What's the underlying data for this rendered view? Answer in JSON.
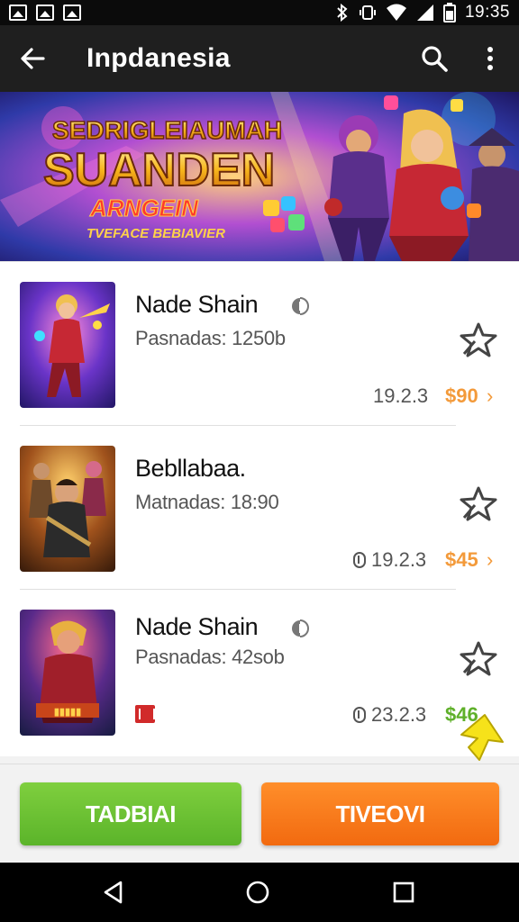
{
  "status_bar": {
    "left_icons": [
      "image-icon",
      "image-icon",
      "image-icon"
    ],
    "right_icons": [
      "bluetooth-icon",
      "vibrate-icon",
      "wifi-icon",
      "signal-icon",
      "battery-icon"
    ],
    "time": "19:35"
  },
  "app_bar": {
    "title": "Inpdanesia",
    "back_icon": "arrow-left-icon",
    "search_icon": "search-icon",
    "more_icon": "more-vertical-icon"
  },
  "banner": {
    "headline_top": "SEDRIGLEIAUMAH",
    "headline_main": "SUANDEN",
    "headline_sub": "ARNGEIN",
    "tagline": "TVEFACE BEBIAVIER"
  },
  "games": [
    {
      "title": "Nade Shain",
      "meta": "Pasnadas: 1250b",
      "version": "19.2.3",
      "price": "$90",
      "price_color": "#f39a3a",
      "show_version_icon": false,
      "show_title_badge": true,
      "show_red_mark": false
    },
    {
      "title": "Bebllabaa.",
      "meta": "Matnadas: 18:90",
      "version": "19.2.3",
      "price": "$45",
      "price_color": "#f39a3a",
      "show_version_icon": true,
      "show_title_badge": false,
      "show_red_mark": false
    },
    {
      "title": "Nade Shain",
      "meta": "Pasnadas: 42sob",
      "version": "23.2.3",
      "price": "$46",
      "price_color": "#5fb02a",
      "show_version_icon": true,
      "show_title_badge": true,
      "show_red_mark": true
    }
  ],
  "buttons": {
    "primary_label": "TADBIAI",
    "secondary_label": "TIVEOVI",
    "primary_color": "#6cc234",
    "secondary_color": "#f57d1f"
  },
  "nav_bar": {
    "back_icon": "nav-back-icon",
    "home_icon": "nav-home-icon",
    "recents_icon": "nav-recents-icon"
  }
}
